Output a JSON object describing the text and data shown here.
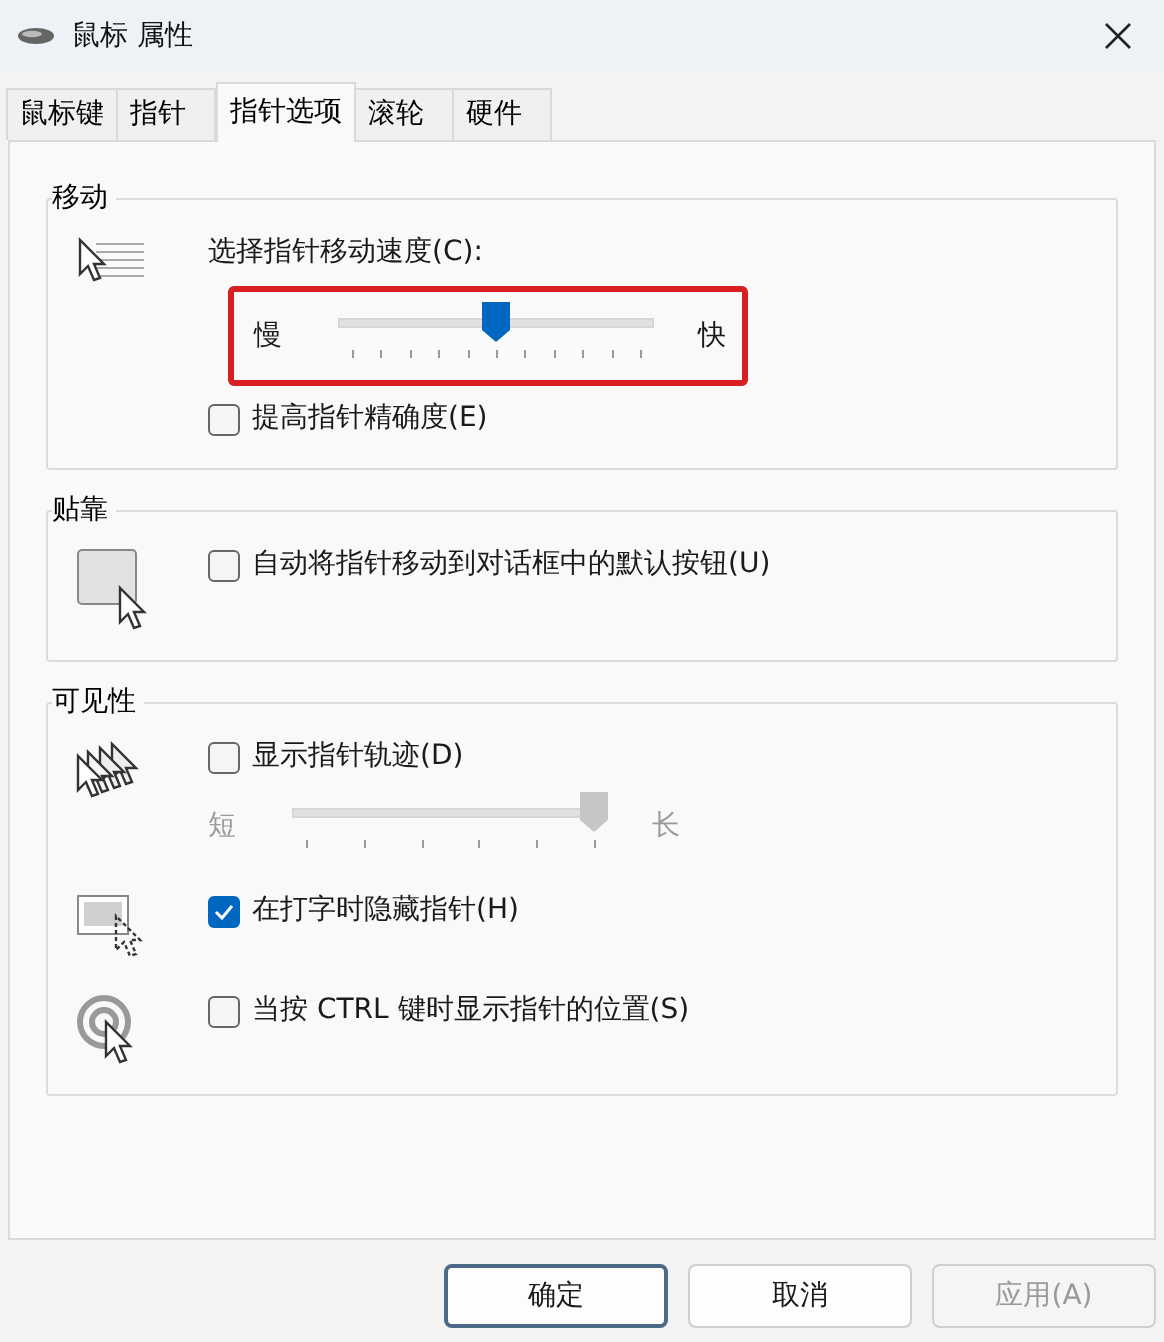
{
  "window": {
    "title": "鼠标 属性"
  },
  "tabs": [
    {
      "label": "鼠标键",
      "selected": false
    },
    {
      "label": "指针",
      "selected": false
    },
    {
      "label": "指针选项",
      "selected": true
    },
    {
      "label": "滚轮",
      "selected": false
    },
    {
      "label": "硬件",
      "selected": false
    }
  ],
  "groups": [
    {
      "title": "移动",
      "rows": [
        {
          "entries": [
            {
              "kind": "label",
              "text": "选择指针移动速度(C):"
            },
            {
              "kind": "fine_slider",
              "min_label": "慢",
              "max_label": "快",
              "level": 0.5,
              "disabled": false,
              "highlighted": true
            },
            {
              "kind": "checkbox",
              "label": "提高指针精确度(E)",
              "checked": false
            }
          ]
        }
      ]
    },
    {
      "title": "贴靠",
      "rows": [
        {
          "entries": [
            {
              "kind": "checkbox",
              "label": "自动将指针移动到对话框中的默认按钮(U)",
              "checked": false
            }
          ]
        }
      ]
    },
    {
      "title": "可见性",
      "rows": [
        {
          "entries": [
            {
              "kind": "checkbox",
              "label": "显示指针轨迹(D)",
              "checked": false
            },
            {
              "kind": "coarse_slider",
              "min_label": "短",
              "max_label": "长",
              "level": 1,
              "disabled": true,
              "highlighted": false
            }
          ]
        },
        {
          "entries": [
            {
              "kind": "checkbox",
              "label": "在打字时隐藏指针(H)",
              "checked": true
            }
          ]
        },
        {
          "entries": [
            {
              "kind": "checkbox",
              "label": "当按 CTRL 键时显示指针的位置(S)",
              "checked": false
            }
          ]
        }
      ]
    }
  ],
  "buttons": [
    {
      "label": "确定",
      "default": true,
      "disabled": false
    },
    {
      "label": "取消",
      "default": false,
      "disabled": false
    },
    {
      "label": "应用(A)",
      "default": false,
      "disabled": true
    }
  ]
}
